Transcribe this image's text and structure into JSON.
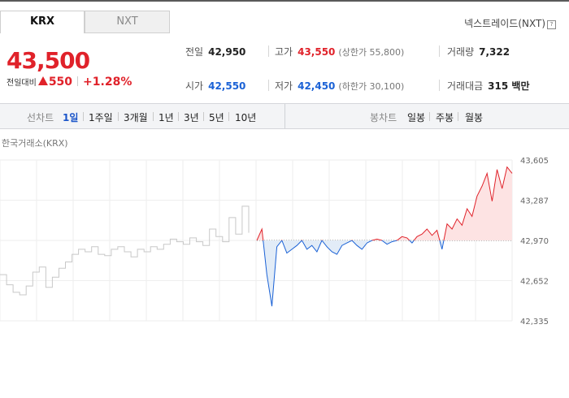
{
  "tabs": [
    {
      "label": "KRX",
      "active": true
    },
    {
      "label": "NXT",
      "active": false
    }
  ],
  "nxt_link": {
    "label": "넥스트레이드(NXT)",
    "help": "?"
  },
  "quote": {
    "price": "43,500",
    "change_label": "전일대비",
    "change_amount": "550",
    "change_pct": "+1.28%",
    "direction": "up",
    "up_color": "#e0222a",
    "down_color": "#1b62d6"
  },
  "stats": {
    "prev_close": {
      "label": "전일",
      "value": "42,950"
    },
    "high": {
      "label": "고가",
      "value": "43,550",
      "sub": "(상한가 55,800)"
    },
    "volume": {
      "label": "거래량",
      "value": "7,322"
    },
    "open": {
      "label": "시가",
      "value": "42,550"
    },
    "low": {
      "label": "저가",
      "value": "42,450",
      "sub": "(하한가 30,100)"
    },
    "trade_value": {
      "label": "거래대금",
      "value": "315 백만"
    }
  },
  "toolbar": {
    "line_chart_label": "선차트",
    "periods": [
      "1일",
      "1주일",
      "3개월",
      "1년",
      "3년",
      "5년",
      "10년"
    ],
    "selected_period": "1일",
    "candle_chart_label": "봉차트",
    "candle_periods": [
      "일봉",
      "주봉",
      "월봉"
    ]
  },
  "chart_data": {
    "type": "line",
    "title": "한국거래소(KRX)",
    "xlabel": "",
    "ylabel": "",
    "y_ticks": [
      "43,605",
      "43,287",
      "42,970",
      "42,652",
      "42,335"
    ],
    "ylim": [
      42335,
      43605
    ],
    "baseline": 42970,
    "grid": true,
    "series": [
      {
        "role": "previous_day",
        "color": "#c8c8c8",
        "values": [
          42700,
          42620,
          42560,
          42540,
          42610,
          42720,
          42760,
          42600,
          42680,
          42750,
          42800,
          42860,
          42900,
          42880,
          42920,
          42860,
          42850,
          42900,
          42920,
          42880,
          42840,
          42900,
          42880,
          42920,
          42900,
          42940,
          42980,
          42960,
          42940,
          42990,
          42960,
          42930,
          43060,
          43000,
          42960,
          43150,
          43020,
          43240,
          43030
        ]
      },
      {
        "role": "today",
        "up_color": "#e0222a",
        "down_color": "#1b62d6",
        "values": [
          42970,
          43060,
          42700,
          42450,
          42920,
          42970,
          42870,
          42900,
          42930,
          42970,
          42900,
          42930,
          42880,
          42970,
          42920,
          42880,
          42860,
          42930,
          42950,
          42970,
          42930,
          42900,
          42950,
          42970,
          42980,
          42970,
          42940,
          42960,
          42970,
          43000,
          42990,
          42950,
          43000,
          43020,
          43060,
          43010,
          43050,
          42900,
          43100,
          43060,
          43140,
          43090,
          43220,
          43160,
          43320,
          43400,
          43500,
          43280,
          43530,
          43380,
          43550,
          43500
        ]
      }
    ]
  }
}
